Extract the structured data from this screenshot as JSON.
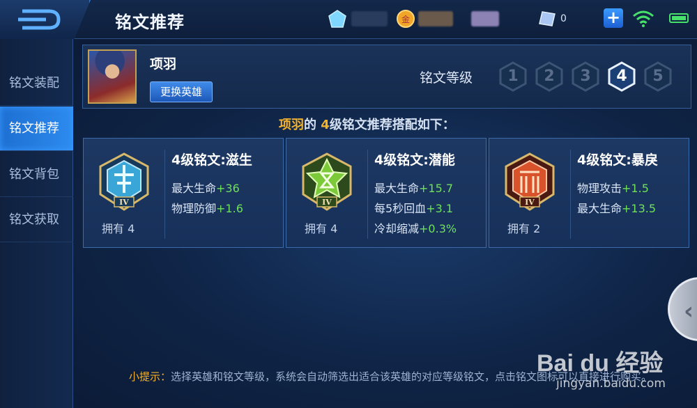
{
  "header": {
    "title": "铭文推荐",
    "resources": [
      {
        "icon": "diamond-icon",
        "value": ""
      },
      {
        "icon": "gold-coin-icon",
        "value": ""
      },
      {
        "icon": "voucher-icon",
        "value": "0"
      }
    ]
  },
  "sidebar": {
    "items": [
      {
        "label": "铭文装配",
        "active": false
      },
      {
        "label": "铭文推荐",
        "active": true
      },
      {
        "label": "铭文背包",
        "active": false
      },
      {
        "label": "铭文获取",
        "active": false
      }
    ]
  },
  "hero": {
    "name": "项羽",
    "change_button": "更换英雄"
  },
  "level_selector": {
    "label": "铭文等级",
    "levels": [
      "1",
      "2",
      "3",
      "4",
      "5"
    ],
    "selected": "4"
  },
  "headline": {
    "hero": "项羽",
    "middle": "的 ",
    "level": "4",
    "rest": "级铭文推荐搭配如下："
  },
  "cards": [
    {
      "title": "4级铭文:滋生",
      "emblem": "blue-hexagon-emblem",
      "color": "#3aa6d8",
      "stats": [
        {
          "name": "最大生命",
          "bonus": "+36"
        },
        {
          "name": "物理防御",
          "bonus": "+1.6"
        }
      ],
      "owned": "拥有 4"
    },
    {
      "title": "4级铭文:潜能",
      "emblem": "green-star-emblem",
      "color": "#7cc93a",
      "stats": [
        {
          "name": "最大生命",
          "bonus": "+15.7"
        },
        {
          "name": "每5秒回血",
          "bonus": "+3.1"
        },
        {
          "name": "冷却缩减",
          "bonus": "+0.3%"
        }
      ],
      "owned": "拥有 4"
    },
    {
      "title": "4级铭文:暴戾",
      "emblem": "red-hexagon-emblem",
      "color": "#d8522c",
      "stats": [
        {
          "name": "物理攻击",
          "bonus": "+1.5"
        },
        {
          "name": "最大生命",
          "bonus": "+13.5"
        }
      ],
      "owned": "拥有 2"
    }
  ],
  "emblem_level": "IV",
  "hint": {
    "label": "小提示：",
    "text": "选择英雄和铭文等级，系统会自动筛选出适合该英雄的对应等级铭文，点击铭文图标可以直接进行购买。"
  },
  "watermark": {
    "logo": "Bai du 经验",
    "url": "jingyan.baidu.com"
  }
}
